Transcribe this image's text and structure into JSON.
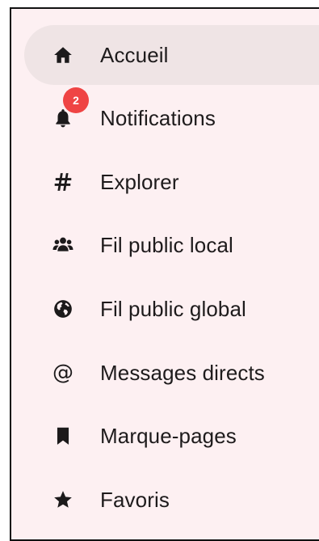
{
  "nav": {
    "items": [
      {
        "label": "Accueil",
        "icon": "home-icon",
        "active": true
      },
      {
        "label": "Notifications",
        "icon": "bell-icon",
        "badge": "2"
      },
      {
        "label": "Explorer",
        "icon": "hashtag-icon"
      },
      {
        "label": "Fil public local",
        "icon": "users-icon"
      },
      {
        "label": "Fil public global",
        "icon": "globe-icon"
      },
      {
        "label": "Messages directs",
        "icon": "at-icon",
        "glyph": "@"
      },
      {
        "label": "Marque-pages",
        "icon": "bookmark-icon"
      },
      {
        "label": "Favoris",
        "icon": "star-icon"
      }
    ]
  },
  "colors": {
    "sidebar_background": "#fdf0f2",
    "active_item_background": "#efe4e5",
    "badge_background": "#ef4444",
    "text": "#1e1b1c"
  }
}
